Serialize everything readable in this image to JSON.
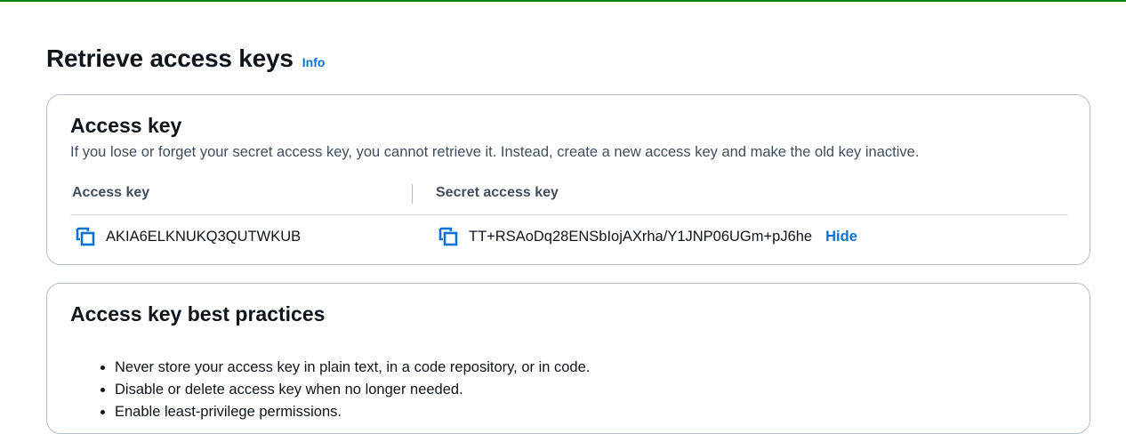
{
  "page": {
    "title": "Retrieve access keys",
    "info_label": "Info"
  },
  "access_key_card": {
    "title": "Access key",
    "description": "If you lose or forget your secret access key, you cannot retrieve it. Instead, create a new access key and make the old key inactive.",
    "columns": [
      "Access key",
      "Secret access key"
    ],
    "access_key_value": "AKIA6ELKNUKQ3QUTWKUB",
    "secret_access_key_value": "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",
    "hide_label": "Hide",
    "copy_icon": "copy-icon"
  },
  "best_practices_card": {
    "title": "Access key best practices",
    "items": [
      "Never store your access key in plain text, in a code repository, or in code.",
      "Disable or delete access key when no longer needed.",
      "Enable least-privilege permissions."
    ]
  },
  "colors": {
    "accent": "#0972d3",
    "success_bar": "#037f0c",
    "border": "#b6bec9",
    "text": "#0f141a",
    "muted_text": "#414d5c"
  }
}
